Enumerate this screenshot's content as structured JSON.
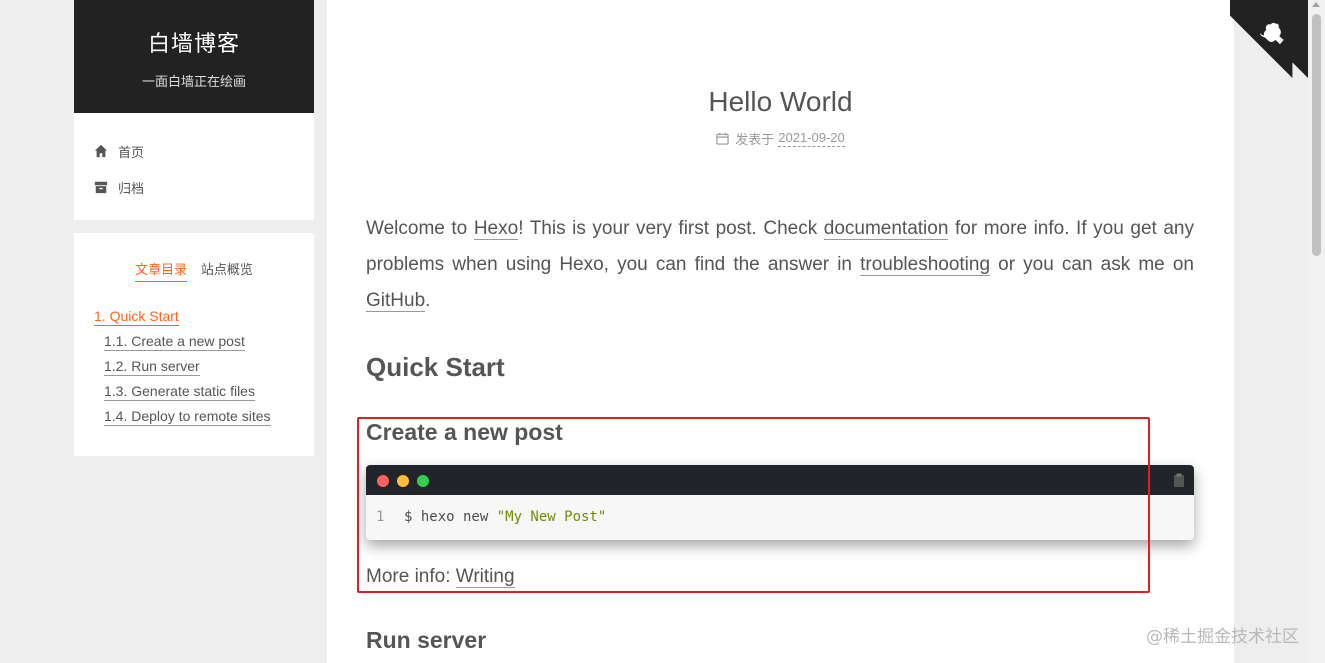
{
  "sidebar": {
    "site_title": "白墙博客",
    "site_subtitle": "一面白墙正在绘画",
    "menu": [
      {
        "label": "首页",
        "icon": "home-icon"
      },
      {
        "label": "归档",
        "icon": "archive-icon"
      }
    ],
    "tabs": {
      "toc": "文章目录",
      "overview": "站点概览"
    },
    "toc": [
      {
        "label": "1. Quick Start",
        "active": true
      },
      {
        "label": "1.1. Create a new post"
      },
      {
        "label": "1.2. Run server"
      },
      {
        "label": "1.3. Generate static files"
      },
      {
        "label": "1.4. Deploy to remote sites"
      }
    ]
  },
  "post": {
    "title": "Hello World",
    "meta_label": "发表于",
    "date": "2021-09-20",
    "intro": {
      "t1": "Welcome to ",
      "link_hexo": "Hexo",
      "t2": "! This is your very first post. Check ",
      "link_docs": "documentation",
      "t3": " for more info. If you get any problems when using Hexo, you can find the answer in ",
      "link_trouble": "troubleshooting",
      "t4": " or you can ask me on ",
      "link_github": "GitHub",
      "t5": "."
    },
    "h_quick_start": "Quick Start",
    "h_create_post": "Create a new post",
    "code": {
      "line_number": "1",
      "command": "$ hexo new ",
      "string": "\"My New Post\""
    },
    "more_info_label": "More info: ",
    "more_info_link": "Writing",
    "h_run_server": "Run server"
  },
  "watermark": "@稀土掘金技术社区",
  "colors": {
    "accent": "#fc6423",
    "brand_bg": "#222222",
    "highlight_border": "#e02020",
    "code_string": "#718c00"
  }
}
